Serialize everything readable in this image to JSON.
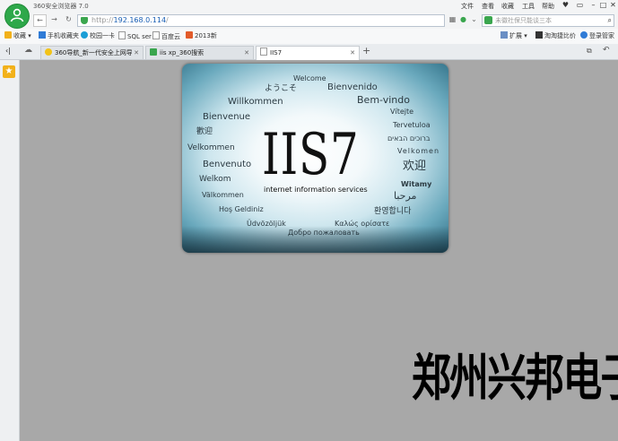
{
  "browser": {
    "app_title": "360安全浏览器 7.0",
    "menu": [
      "文件",
      "查看",
      "收藏",
      "工具",
      "帮助"
    ]
  },
  "navbar": {
    "url_proto": "http://",
    "url_host": "192.168.0.114",
    "url_path": "/",
    "search_placeholder": "未徽社保只能谈三本"
  },
  "bookmarks": {
    "items": [
      "收藏",
      "手机收藏夹",
      "校园一卡",
      "SQL ser",
      "百度云",
      "2013新"
    ],
    "right": [
      "扩展",
      "淘淘捷比价",
      "登录管家"
    ]
  },
  "tabs": [
    {
      "label": "360导航_新一代安全上网导航",
      "active": false
    },
    {
      "label": "iis xp_360搜索",
      "active": false
    },
    {
      "label": "IIS7",
      "active": true
    }
  ],
  "iis": {
    "logo": "IIS7",
    "subtitle": "internet information services",
    "words": [
      "Welcome",
      "ようこそ",
      "Bienvenido",
      "Willkommen",
      "Bem-vindo",
      "Vítejte",
      "Bienvenue",
      "Tervetuloa",
      "歡迎",
      "ברוכים הבאים",
      "Velkommen",
      "Velkomen",
      "Benvenuto",
      "欢迎",
      "Welkom",
      "Witamy",
      "Välkommen",
      "مرحبا",
      "Hoş Geldiniz",
      "환영합니다",
      "Üdvözöljük",
      "Καλώς ορίσατε",
      "Добро пожаловать"
    ]
  },
  "watermark": "郑州兴邦电子",
  "colors": {
    "accent_green": "#2ea84a",
    "iis_teal": "#2c6c83"
  }
}
